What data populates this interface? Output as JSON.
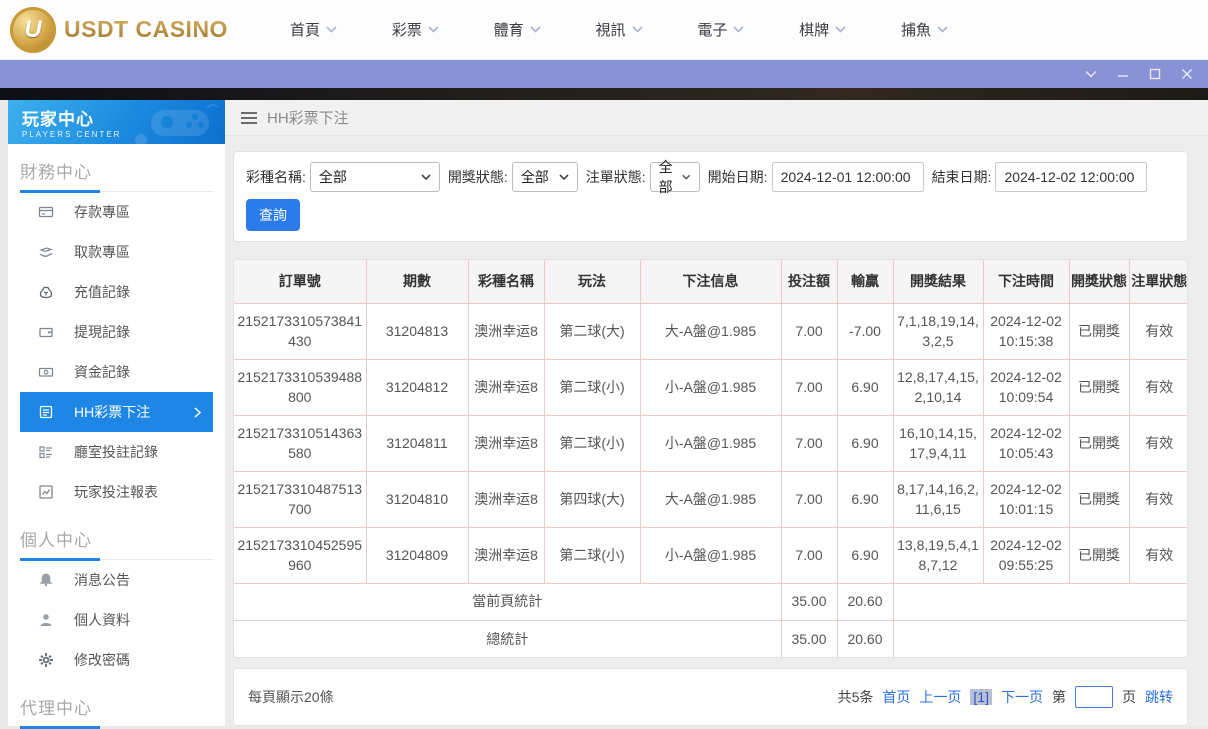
{
  "topnav": {
    "brand": "USDT CASINO",
    "items": [
      {
        "label": "首頁"
      },
      {
        "label": "彩票"
      },
      {
        "label": "體育"
      },
      {
        "label": "視訊"
      },
      {
        "label": "電子"
      },
      {
        "label": "棋牌"
      },
      {
        "label": "捕魚"
      }
    ]
  },
  "sidebar": {
    "title": "玩家中心",
    "subtitle": "PLAYERS CENTER",
    "sections": [
      {
        "title": "財務中心",
        "items": [
          {
            "label": "存款專區",
            "icon": "deposit-card-icon",
            "active": false
          },
          {
            "label": "取款專區",
            "icon": "withdraw-hand-icon",
            "active": false
          },
          {
            "label": "充值記錄",
            "icon": "recharge-bag-icon",
            "active": false
          },
          {
            "label": "提現記錄",
            "icon": "wallet-icon",
            "active": false
          },
          {
            "label": "資金記錄",
            "icon": "banknote-icon",
            "active": false
          },
          {
            "label": "HH彩票下注",
            "icon": "lottery-doc-icon",
            "active": true
          },
          {
            "label": "廳室投註記錄",
            "icon": "hall-list-icon",
            "active": false
          },
          {
            "label": "玩家投注報表",
            "icon": "report-chart-icon",
            "active": false
          }
        ]
      },
      {
        "title": "個人中心",
        "items": [
          {
            "label": "消息公告",
            "icon": "bell-icon",
            "active": false
          },
          {
            "label": "個人資料",
            "icon": "person-icon",
            "active": false
          },
          {
            "label": "修改密碼",
            "icon": "gear-icon",
            "active": false
          }
        ]
      },
      {
        "title": "代理中心",
        "items": []
      }
    ]
  },
  "main": {
    "page_title": "HH彩票下注",
    "filters": {
      "lottery_label": "彩種名稱:",
      "lottery_value": "全部",
      "draw_status_label": "開獎狀態:",
      "draw_status_value": "全部",
      "order_status_label": "注單狀態:",
      "order_status_value": "全部",
      "start_label": "開始日期:",
      "start_value": "2024-12-01 12:00:00",
      "end_label": "結束日期:",
      "end_value": "2024-12-02 12:00:00",
      "search_label": "查詢"
    },
    "table": {
      "headers": [
        "訂單號",
        "期數",
        "彩種名稱",
        "玩法",
        "下注信息",
        "投注額",
        "輸贏",
        "開獎結果",
        "下注時間",
        "開獎狀態",
        "注單狀態"
      ],
      "rows": [
        [
          "2152173310573841430",
          "31204813",
          "澳洲幸运8",
          "第二球(大)",
          "大-A盤@1.985",
          "7.00",
          "-7.00",
          "7,1,18,19,14,3,2,5",
          "2024-12-02 10:15:38",
          "已開獎",
          "有效"
        ],
        [
          "2152173310539488800",
          "31204812",
          "澳洲幸运8",
          "第二球(小)",
          "小-A盤@1.985",
          "7.00",
          "6.90",
          "12,8,17,4,15,2,10,14",
          "2024-12-02 10:09:54",
          "已開獎",
          "有效"
        ],
        [
          "2152173310514363580",
          "31204811",
          "澳洲幸运8",
          "第二球(小)",
          "小-A盤@1.985",
          "7.00",
          "6.90",
          "16,10,14,15,17,9,4,11",
          "2024-12-02 10:05:43",
          "已開獎",
          "有效"
        ],
        [
          "2152173310487513700",
          "31204810",
          "澳洲幸运8",
          "第四球(大)",
          "大-A盤@1.985",
          "7.00",
          "6.90",
          "8,17,14,16,2,11,6,15",
          "2024-12-02 10:01:15",
          "已開獎",
          "有效"
        ],
        [
          "2152173310452595960",
          "31204809",
          "澳洲幸运8",
          "第二球(小)",
          "小-A盤@1.985",
          "7.00",
          "6.90",
          "13,8,19,5,4,18,7,12",
          "2024-12-02 09:55:25",
          "已開獎",
          "有效"
        ]
      ],
      "summary": [
        {
          "label": "當前頁統計",
          "bet_total": "35.00",
          "winloss_total": "20.60"
        },
        {
          "label": "總統計",
          "bet_total": "35.00",
          "winloss_total": "20.60"
        }
      ]
    },
    "pagination": {
      "page_size_text": "每頁顯示20條",
      "total_text": "共5条",
      "first_label": "首页",
      "prev_label": "上一页",
      "current_page": "[1]",
      "next_label": "下一页",
      "jump_prefix": "第",
      "jump_suffix": "页",
      "jump_action": "跳转"
    }
  },
  "colors": {
    "accent_blue": "#1e87e5",
    "button_blue": "#2b7cea",
    "link_blue": "#2a6fdb",
    "titlebar_purple": "#8a92d6",
    "table_border_pink": "#f0c8c8",
    "brand_gold": "#b08a3a"
  }
}
